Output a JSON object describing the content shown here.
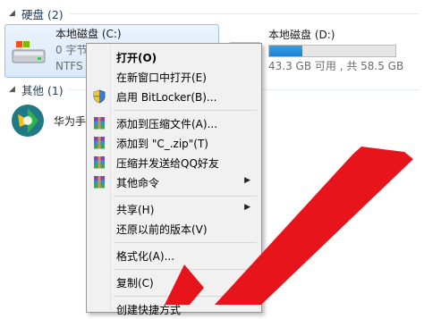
{
  "groups": {
    "disks": {
      "title": "硬盘 (2)"
    },
    "other": {
      "title": "其他 (1)"
    }
  },
  "drive_c": {
    "name": "本地磁盘 (C:)",
    "size_text": "0 字节",
    "filesystem": "NTFS"
  },
  "drive_d": {
    "name": "本地磁盘 (D:)",
    "free_text": "43.3 GB 可用 , 共 58.5 GB",
    "used_fraction": 0.26,
    "bar_color": "#1d7fd0"
  },
  "other_item": {
    "label": "华为手"
  },
  "context_menu": {
    "items": [
      {
        "label": "打开(O)",
        "bold": true
      },
      {
        "label": "在新窗口中打开(E)"
      },
      {
        "label": "启用 BitLocker(B)...",
        "icon": "shield-icon"
      },
      {
        "label": "添加到压缩文件(A)...",
        "icon": "winrar-icon"
      },
      {
        "label": "添加到 \"C_.zip\"(T)",
        "icon": "winrar-icon"
      },
      {
        "label": "压缩并发送给QQ好友",
        "icon": "winrar-icon"
      },
      {
        "label": "其他命令",
        "icon": "winrar-icon",
        "submenu": true
      },
      {
        "label": "共享(H)",
        "submenu": true
      },
      {
        "label": "还原以前的版本(V)"
      },
      {
        "label": "格式化(A)..."
      },
      {
        "label": "复制(C)"
      },
      {
        "label": "创建快捷方式"
      }
    ]
  },
  "colors": {
    "selection_bg": "#dbe9f9",
    "annotation_arrow": "#e8141b"
  }
}
